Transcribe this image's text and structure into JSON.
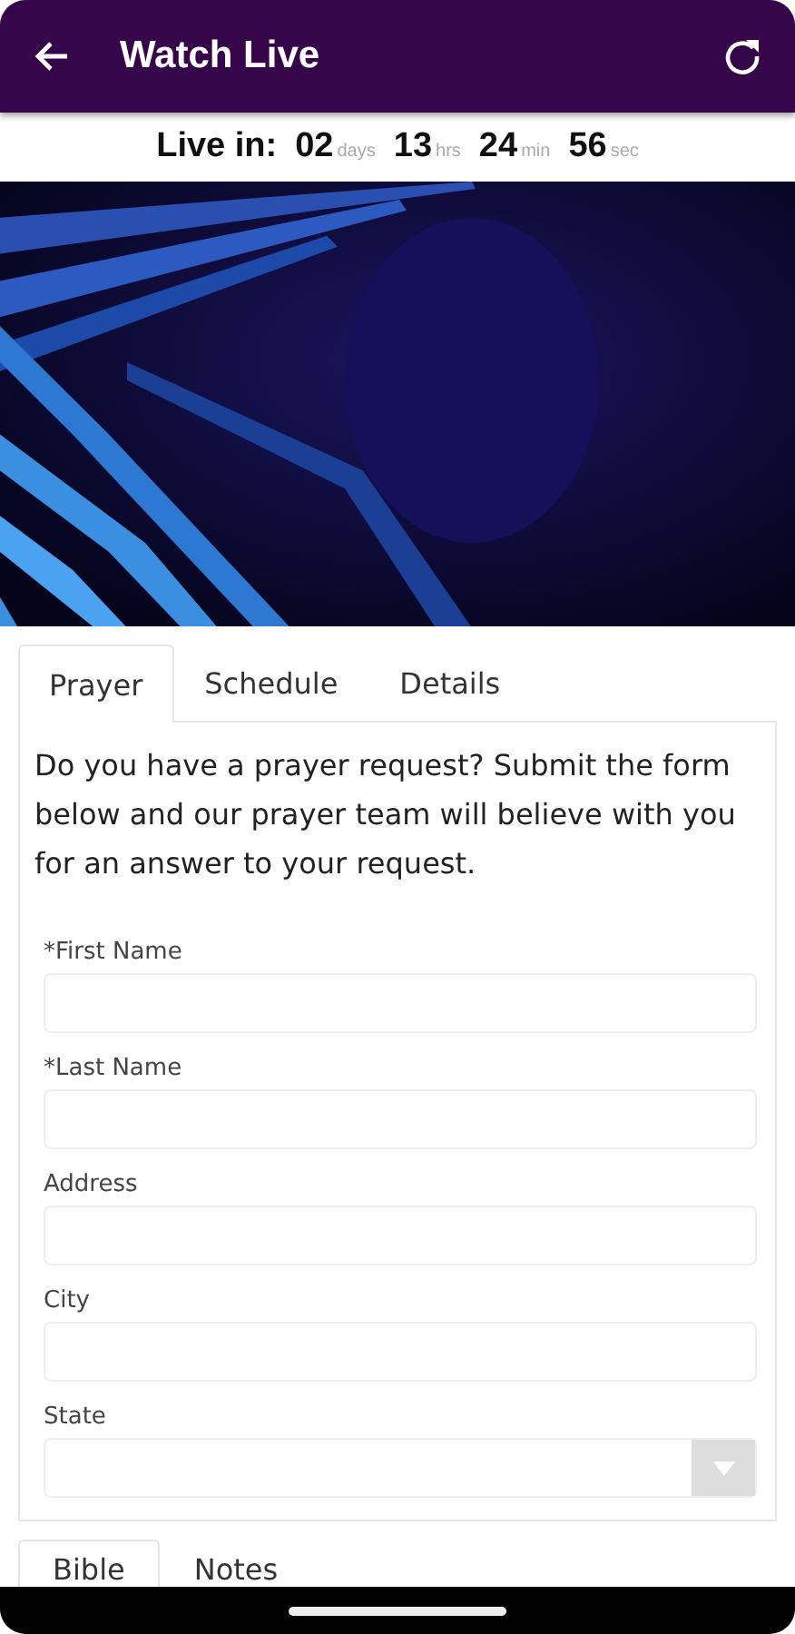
{
  "app_bar": {
    "title": "Watch Live"
  },
  "countdown": {
    "label": "Live in:",
    "parts": [
      {
        "value": "02",
        "unit": "days"
      },
      {
        "value": "13",
        "unit": "hrs"
      },
      {
        "value": "24",
        "unit": "min"
      },
      {
        "value": "56",
        "unit": "sec"
      }
    ]
  },
  "tabs": [
    {
      "label": "Prayer",
      "selected": true
    },
    {
      "label": "Schedule",
      "selected": false
    },
    {
      "label": "Details",
      "selected": false
    }
  ],
  "prayer_form": {
    "intro": "Do you have a prayer request? Submit the form below and our prayer team will believe with you for an answer to your request.",
    "fields": [
      {
        "kind": "text",
        "label": "*First Name"
      },
      {
        "kind": "text",
        "label": "*Last Name"
      },
      {
        "kind": "text",
        "label": "Address"
      },
      {
        "kind": "text",
        "label": "City"
      },
      {
        "kind": "select",
        "label": "State"
      }
    ]
  },
  "bottom_tabs": [
    {
      "label": "Bible",
      "selected": true
    },
    {
      "label": "Notes",
      "selected": false
    }
  ]
}
